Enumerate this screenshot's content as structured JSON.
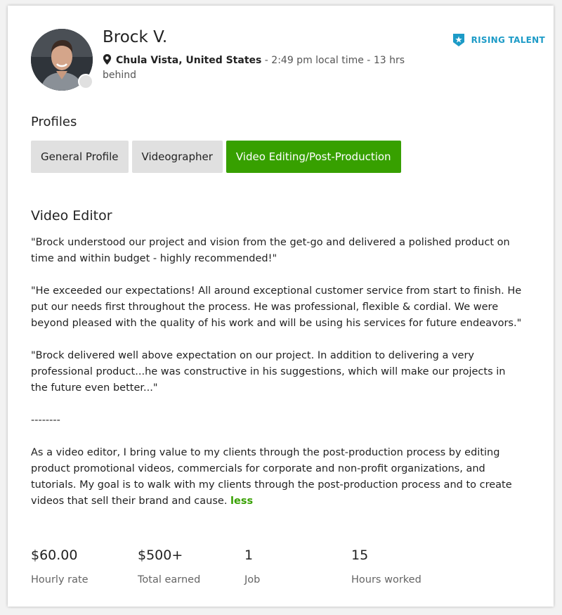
{
  "profile": {
    "name": "Brock V.",
    "city": "Chula Vista, United States",
    "local_time": " - 2:49 pm local time - 13 hrs behind",
    "badge": "RISING TALENT"
  },
  "profiles_section": {
    "title": "Profiles",
    "tabs": [
      {
        "label": "General Profile",
        "active": false
      },
      {
        "label": "Videographer",
        "active": false
      },
      {
        "label": "Video Editing/Post-Production",
        "active": true
      }
    ]
  },
  "overview": {
    "title": "Video Editor",
    "paragraphs": [
      "\"Brock understood our project and vision from the get-go and delivered a polished product on time and within budget - highly recommended!\"",
      "\"He exceeded our expectations! All around exceptional customer service from start to finish. He put our needs first throughout the process. He was professional, flexible & cordial. We were beyond pleased with the quality of his work and will be using his services for future endeavors.\"",
      "\"Brock delivered well above expectation on our project. In addition to delivering a very professional product...he was constructive in his suggestions, which will make our projects in the future even better...\"",
      "--------",
      "As a video editor, I bring value to my clients through the post-production process by editing product promotional videos, commercials for corporate and non-profit organizations, and tutorials. My goal is to walk with my clients through the post-production process and to create videos that sell their brand and cause. "
    ],
    "less_link": "less"
  },
  "stats": [
    {
      "value": "$60.00",
      "label": "Hourly rate"
    },
    {
      "value": "$500+",
      "label": "Total earned"
    },
    {
      "value": "1",
      "label": "Job"
    },
    {
      "value": "15",
      "label": "Hours worked"
    }
  ],
  "colors": {
    "accent": "#37a000",
    "badge": "#1d9bc7"
  }
}
